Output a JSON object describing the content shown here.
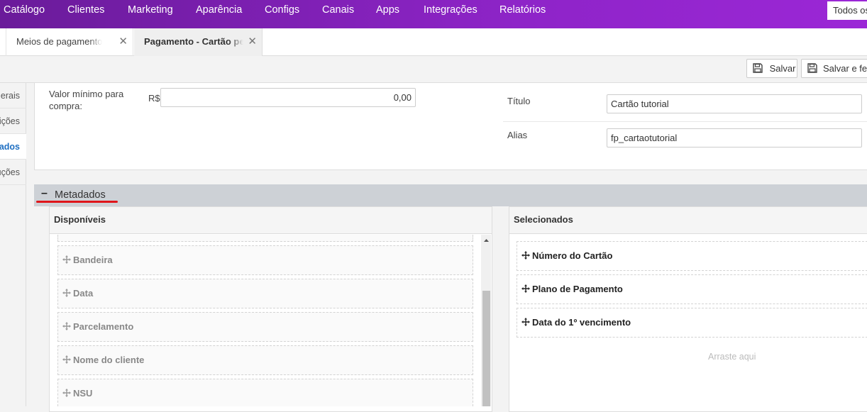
{
  "nav": {
    "items": [
      "Catálogo",
      "Clientes",
      "Marketing",
      "Aparência",
      "Configs",
      "Canais",
      "Apps",
      "Integrações",
      "Relatórios"
    ],
    "search_text": "Todos os"
  },
  "tabs": [
    {
      "label": "Meios de pagamento",
      "close": "✕"
    },
    {
      "label": "Pagamento - Cartão personalizado",
      "close": "✕"
    }
  ],
  "toolbar": {
    "save_label": "Salvar",
    "save_close_label": "Salvar e fechar"
  },
  "sidebar": {
    "items": [
      "Gerais",
      "Restrições",
      "Metadados",
      "Instruções"
    ],
    "active_index": 2
  },
  "form": {
    "min_value_label": "Valor mínimo para compra:",
    "currency": "R$",
    "min_value": "0,00",
    "title_label": "Título",
    "title_value": "Cartão tutorial",
    "alias_label": "Alias",
    "alias_value": "fp_cartaotutorial"
  },
  "metadata": {
    "section_title": "Metadados",
    "collapse_symbol": "–",
    "available_title": "Disponíveis",
    "selected_title": "Selecionados",
    "available": [
      "Bandeira",
      "Data",
      "Parcelamento",
      "Nome do cliente",
      "NSU"
    ],
    "selected": [
      "Número do Cartão",
      "Plano de Pagamento",
      "Data do 1º vencimento"
    ],
    "drop_hint": "Arraste aqui"
  },
  "colors": {
    "nav_start": "#6a1b9a",
    "nav_end": "#9b27d6",
    "active_link": "#1e6fc2",
    "highlight_mark": "#e0161b"
  }
}
